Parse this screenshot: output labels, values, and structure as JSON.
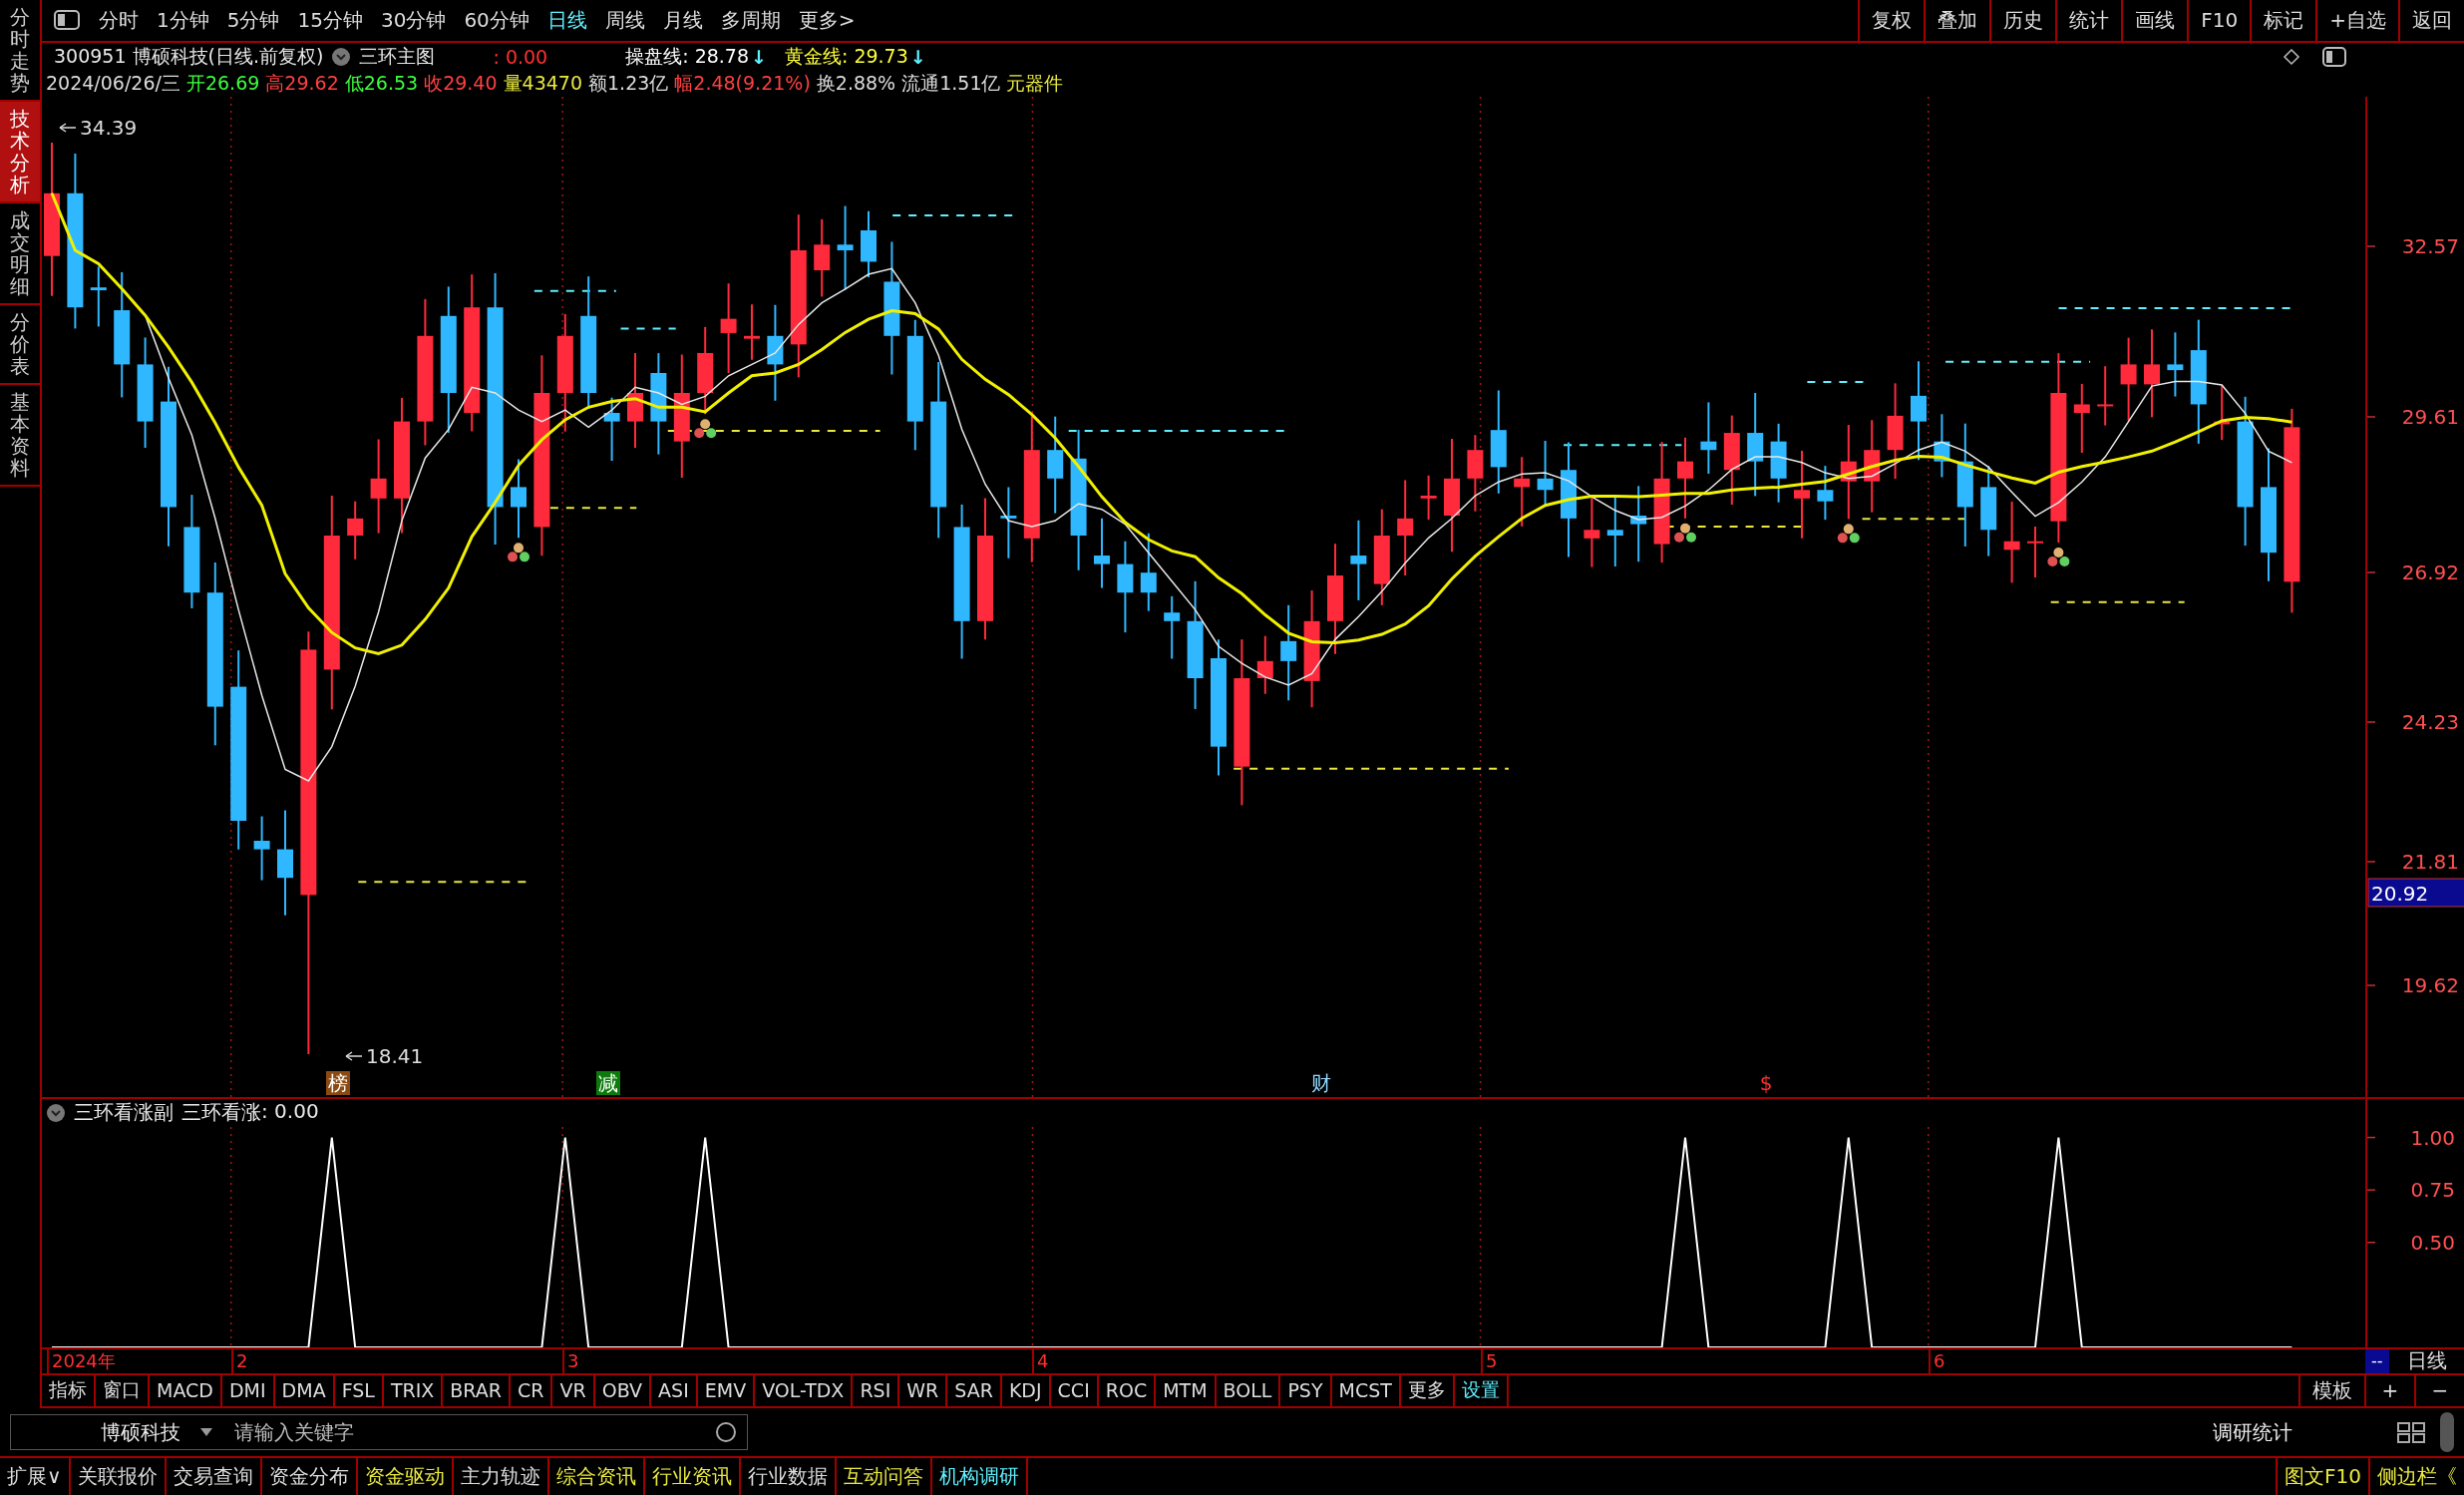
{
  "side_tabs": [
    {
      "label": "分时走势",
      "selected": false
    },
    {
      "label": "技术分析",
      "selected": true
    },
    {
      "label": "成交明细",
      "selected": false
    },
    {
      "label": "分价表",
      "selected": false
    },
    {
      "label": "基本资料",
      "selected": false
    }
  ],
  "periods": [
    {
      "label": "分时",
      "selected": false
    },
    {
      "label": "1分钟",
      "selected": false
    },
    {
      "label": "5分钟",
      "selected": false
    },
    {
      "label": "15分钟",
      "selected": false
    },
    {
      "label": "30分钟",
      "selected": false
    },
    {
      "label": "60分钟",
      "selected": false
    },
    {
      "label": "日线",
      "selected": true
    },
    {
      "label": "周线",
      "selected": false
    },
    {
      "label": "月线",
      "selected": false
    },
    {
      "label": "多周期",
      "selected": false
    },
    {
      "label": "更多>",
      "selected": false
    }
  ],
  "actions": [
    "复权",
    "叠加",
    "历史",
    "统计",
    "画线",
    "F10",
    "标记",
    "+自选",
    "返回"
  ],
  "quote": {
    "title": "300951 博硕科技(日线.前复权)",
    "indicator": "三环主图",
    "indicator_value": ": 0.00",
    "lines": [
      {
        "label": "操盘线: 28.78",
        "arrow": "↓",
        "color": "#ffffff"
      },
      {
        "label": "黄金线: 29.73",
        "arrow": "↓",
        "color": "#ffff3c"
      }
    ],
    "stats": [
      {
        "text": "2024/06/26/三",
        "color": "#dddddd"
      },
      {
        "text": "开26.69",
        "color": "#3cff3c"
      },
      {
        "text": "高29.62",
        "color": "#ff4040"
      },
      {
        "text": "低26.53",
        "color": "#3cff3c"
      },
      {
        "text": "收29.40",
        "color": "#ff4040"
      },
      {
        "text": "量43470",
        "color": "#e8e840"
      },
      {
        "text": "额1.23亿",
        "color": "#dddddd"
      },
      {
        "text": "幅2.48(9.21%)",
        "color": "#ff4040"
      },
      {
        "text": "换2.88%",
        "color": "#dddddd"
      },
      {
        "text": "流通1.51亿",
        "color": "#dddddd"
      },
      {
        "text": "元器件",
        "color": "#e8e840"
      }
    ]
  },
  "chart": {
    "price_axis": [
      "32.57",
      "29.61",
      "26.92",
      "24.23",
      "21.81",
      "19.62"
    ],
    "cursor_price": "20.92",
    "high_label": "34.39",
    "low_label": "18.41",
    "event_marks": [
      {
        "label": "榜",
        "kind": "rank"
      },
      {
        "label": "减",
        "kind": "reduce"
      },
      {
        "label": "财",
        "kind": "finance"
      },
      {
        "label": "$",
        "kind": "dividend"
      }
    ]
  },
  "indicator_panel": {
    "title": "三环看涨副",
    "value": ": 0.00",
    "chart_data": {
      "type": "line",
      "ylim": [
        0,
        1.05
      ],
      "yticks": [
        {
          "value": 1,
          "label": "1.00"
        },
        {
          "value": 0.75,
          "label": "0.75"
        },
        {
          "value": 0.5,
          "label": "0.50"
        }
      ],
      "series": [
        {
          "name": "三环看涨",
          "color": "#ffffff",
          "values": [
            0,
            0,
            0,
            0,
            0,
            0,
            0,
            0,
            0,
            0,
            0,
            0,
            1,
            0,
            0,
            0,
            0,
            0,
            0,
            0,
            0,
            0,
            1,
            0,
            0,
            0,
            0,
            0,
            1,
            0,
            0,
            0,
            0,
            0,
            0,
            0,
            0,
            0,
            0,
            0,
            0,
            0,
            0,
            0,
            0,
            0,
            0,
            0,
            0,
            0,
            0,
            0,
            0,
            0,
            0,
            0,
            0,
            0,
            0,
            0,
            0,
            0,
            0,
            0,
            0,
            0,
            0,
            0,
            0,
            0,
            1,
            0,
            0,
            0,
            0,
            0,
            0,
            1,
            0,
            0,
            0,
            0,
            0,
            0,
            0,
            0,
            1,
            0,
            0,
            0,
            0,
            0,
            0,
            0,
            0,
            0,
            0
          ]
        }
      ]
    }
  },
  "date_axis": {
    "labels": [
      "2024年",
      "2",
      "3",
      "4",
      "5",
      "6"
    ],
    "cursor_date": "--",
    "period": "日线"
  },
  "indicator_tabs": [
    {
      "label": "指标",
      "kind": "tab"
    },
    {
      "label": "窗口",
      "kind": "tab"
    },
    {
      "label": "MACD",
      "kind": "tab"
    },
    {
      "label": "DMI",
      "kind": "tab"
    },
    {
      "label": "DMA",
      "kind": "tab"
    },
    {
      "label": "FSL",
      "kind": "tab"
    },
    {
      "label": "TRIX",
      "kind": "tab"
    },
    {
      "label": "BRAR",
      "kind": "tab"
    },
    {
      "label": "CR",
      "kind": "tab"
    },
    {
      "label": "VR",
      "kind": "tab"
    },
    {
      "label": "OBV",
      "kind": "tab"
    },
    {
      "label": "ASI",
      "kind": "tab"
    },
    {
      "label": "EMV",
      "kind": "tab"
    },
    {
      "label": "VOL-TDX",
      "kind": "tab"
    },
    {
      "label": "RSI",
      "kind": "tab"
    },
    {
      "label": "WR",
      "kind": "tab"
    },
    {
      "label": "SAR",
      "kind": "tab"
    },
    {
      "label": "KDJ",
      "kind": "tab"
    },
    {
      "label": "CCI",
      "kind": "tab"
    },
    {
      "label": "ROC",
      "kind": "tab"
    },
    {
      "label": "MTM",
      "kind": "tab"
    },
    {
      "label": "BOLL",
      "kind": "tab"
    },
    {
      "label": "PSY",
      "kind": "tab"
    },
    {
      "label": "MCST",
      "kind": "tab"
    },
    {
      "label": "更多",
      "kind": "tab"
    },
    {
      "label": "设置",
      "kind": "setting"
    }
  ],
  "template_buttons": [
    "模板",
    "+",
    "−"
  ],
  "search_row": {
    "stock": "博硕科技",
    "search_placeholder": "请输入关键字",
    "stats_link": "调研统计"
  },
  "bottom_tabs": [
    {
      "label": "扩展∨",
      "color": "#dddddd"
    },
    {
      "label": "关联报价",
      "color": "#dddddd"
    },
    {
      "label": "交易查询",
      "color": "#dddddd"
    },
    {
      "label": "资金分布",
      "color": "#dddddd"
    },
    {
      "label": "资金驱动",
      "color": "#e8e840"
    },
    {
      "label": "主力轨迹",
      "color": "#dddddd"
    },
    {
      "label": "综合资讯",
      "color": "#e8e840"
    },
    {
      "label": "行业资讯",
      "color": "#e8e840"
    },
    {
      "label": "行业数据",
      "color": "#dddddd"
    },
    {
      "label": "互动问答",
      "color": "#e8e840"
    },
    {
      "label": "机构调研",
      "color": "#5ff0ff"
    }
  ],
  "bottom_right": [
    "图文F10",
    "侧边栏《"
  ]
}
